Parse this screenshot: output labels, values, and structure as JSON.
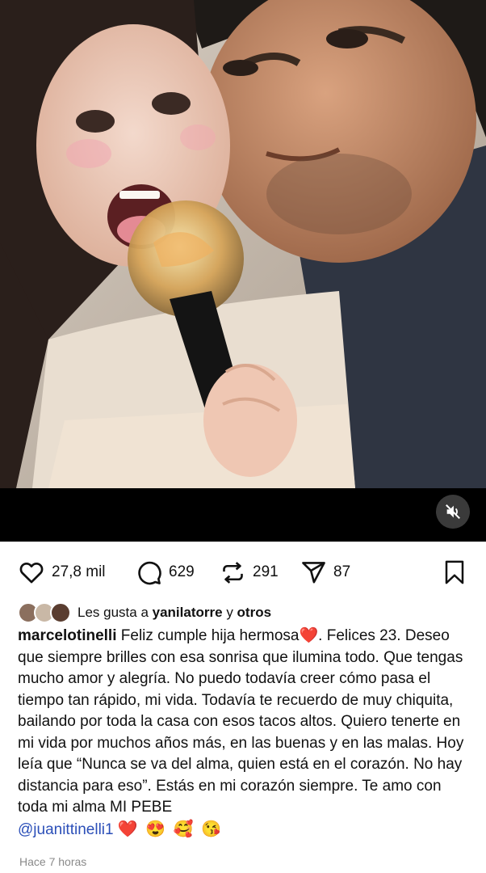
{
  "post": {
    "mute_icon": "speaker-muted-icon",
    "actions": {
      "likes": "27,8 mil",
      "comments": "629",
      "reposts": "291",
      "shares": "87"
    },
    "liked_by": {
      "prefix": "Les gusta a",
      "user": "yanilatorre",
      "joiner": "y",
      "others": "otros"
    },
    "caption": {
      "username": "marcelotinelli",
      "part1": "Feliz cumple hija hermosa",
      "heart": "❤️",
      "part2": ". Felices 23. Deseo que siempre brilles con esa sonrisa que ilumina todo. Que tengas mucho amor y alegría. No puedo todavía creer cómo pasa el tiempo tan rápido, mi vida. Todavía te recuerdo de muy chiquita, bailando por toda la casa con esos tacos altos. Quiero tenerte en mi vida por muchos años más, en las buenas y en las malas. Hoy leía que “Nunca se va del alma, quien está en el corazón. No hay distancia para eso”. Estás en mi corazón siempre. Te amo con toda mi alma MI PEBE",
      "mention": "@juanittinelli1",
      "emojis": "❤️ 😍 🥰 😘"
    },
    "timestamp": "Hace 7 horas"
  },
  "colors": {
    "mention": "#2b4fb8",
    "heart": "#e0245e",
    "timestamp": "#8a8a8a"
  }
}
